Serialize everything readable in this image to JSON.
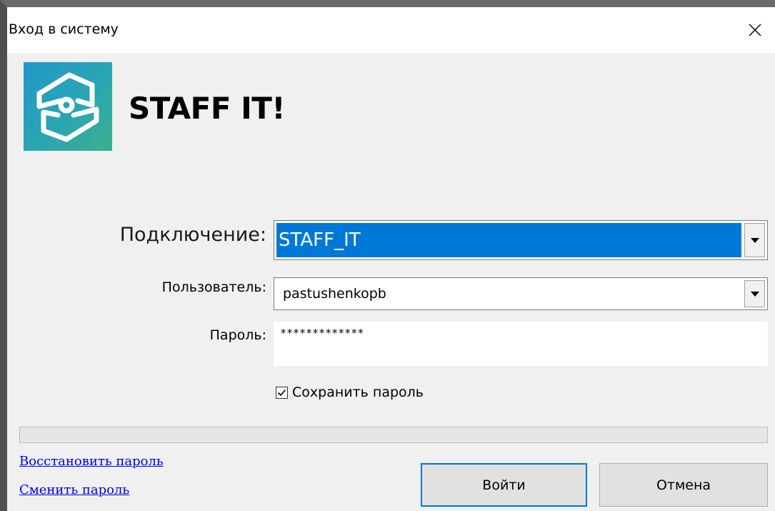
{
  "window": {
    "title": "Вход в систему"
  },
  "app": {
    "name": "STAFF IT!"
  },
  "form": {
    "connection_label": "Подключение:",
    "connection_value": "STAFF_IT",
    "user_label": "Пользователь:",
    "user_value": "pastushenkopb",
    "password_label": "Пароль:",
    "password_value": "*************",
    "save_password_label": "Сохранить пароль",
    "save_password_checked": true
  },
  "progress": {
    "value_percent": 0
  },
  "links": {
    "restore_password": "Восстановить пароль",
    "change_password": "Сменить пароль"
  },
  "buttons": {
    "login": "Войти",
    "cancel": "Отмена"
  },
  "icons": {
    "close": "close-icon",
    "logo": "staff-it-logo-icon",
    "dropdown": "chevron-down-icon",
    "checkbox": "checkmark-icon"
  },
  "colors": {
    "selection": "#0078d7",
    "link": "#0000ee",
    "logo_start": "#2196c9",
    "logo_end": "#3dae8c"
  }
}
